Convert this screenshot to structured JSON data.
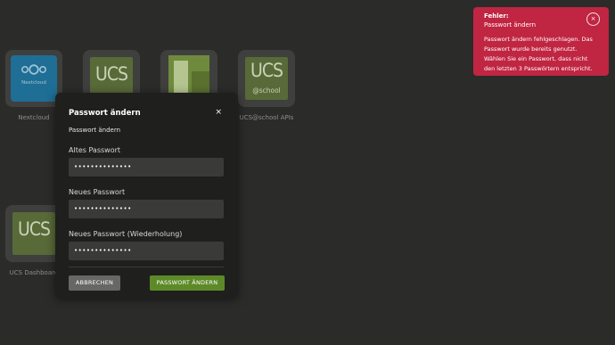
{
  "tiles": {
    "nextcloud": {
      "label": "Nextcloud",
      "logo_text": "Nextcloud"
    },
    "tile2": {
      "label": "",
      "logo_text": "UCS"
    },
    "tile3": {
      "label": ""
    },
    "school_apis": {
      "label": "UCS@school APIs",
      "logo_text": "UCS",
      "logo_sub": "@school"
    },
    "dashboard": {
      "label": "UCS Dashboard",
      "logo_text": "UCS"
    }
  },
  "dialog": {
    "title": "Passwort ändern",
    "close_symbol": "×",
    "subtitle": "Passwort ändern",
    "fields": [
      {
        "label": "Altes Passwort",
        "value": "••••••••••••••"
      },
      {
        "label": "Neues Passwort",
        "value": "••••••••••••••"
      },
      {
        "label": "Neues Passwort (Wiederholung)",
        "value": "••••••••••••••"
      }
    ],
    "cancel_label": "ABBRECHEN",
    "submit_label": "PASSWORT ÄNDERN"
  },
  "notification": {
    "title": "Fehler:",
    "subtitle": "Passwort ändern",
    "message": "Passwort ändern fehlgeschlagen. Das Passwort wurde bereits genutzt. Wählen Sie ein Passwort, dass nicht den letzten 3 Passwörtern entspricht.",
    "close_symbol": "×"
  },
  "colors": {
    "background": "#2b2b2a",
    "dialog": "#1f1f1e",
    "submit": "#5d8a28",
    "error": "#c02541",
    "ucs_green": "#586a38",
    "nextcloud_blue": "#1e6e95"
  }
}
